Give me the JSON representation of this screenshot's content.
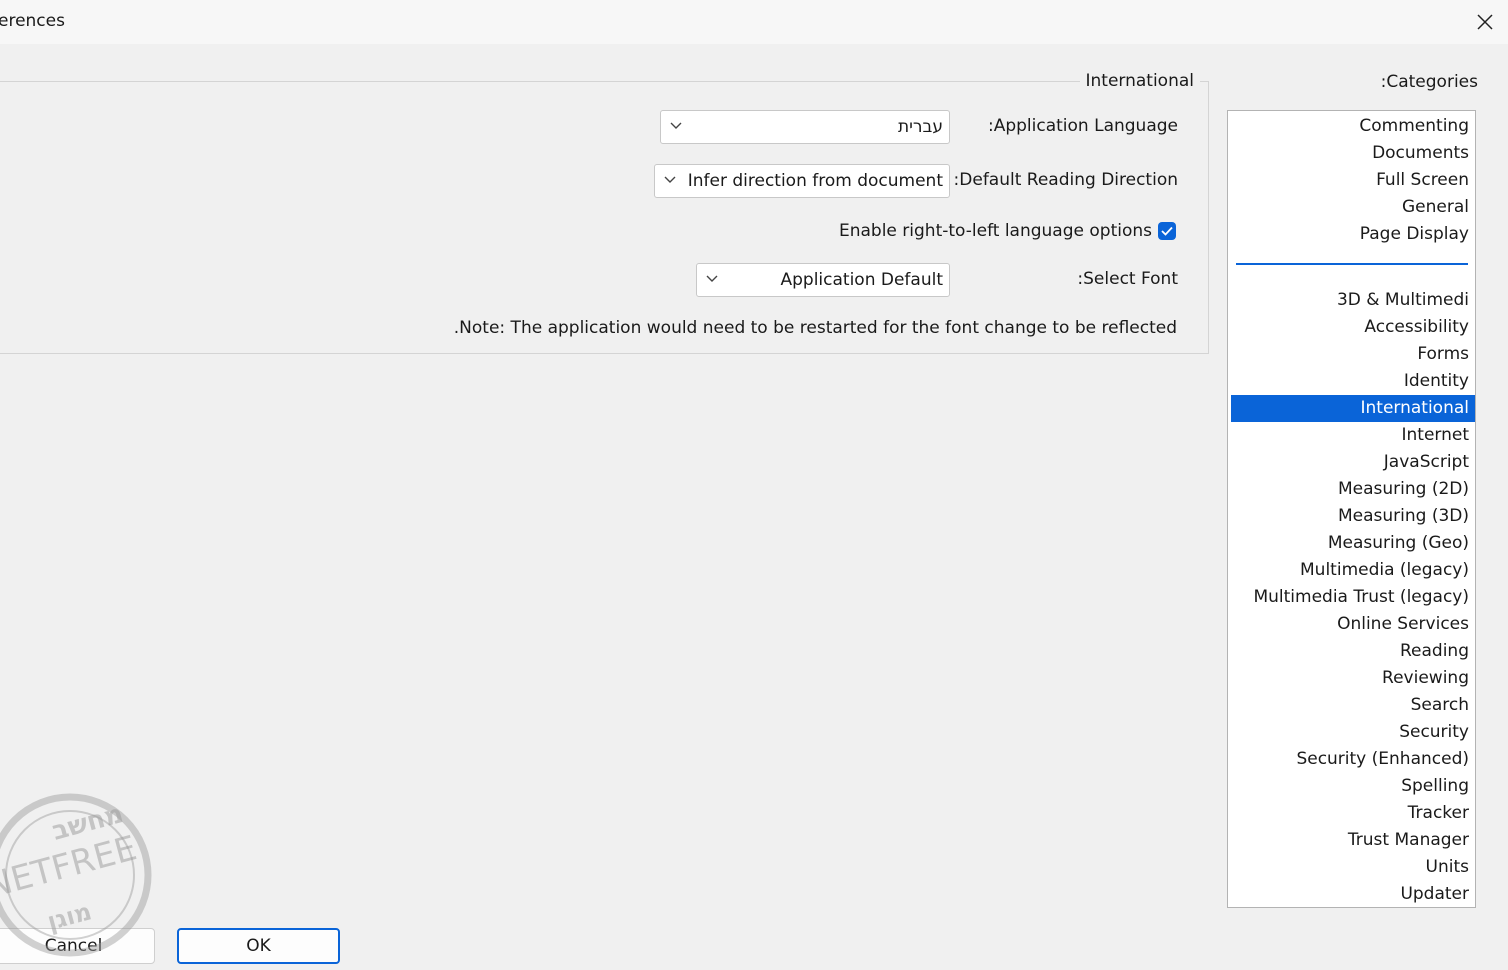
{
  "window": {
    "title": "erences",
    "close_icon": "close-icon"
  },
  "categories": {
    "label": ":Categories",
    "top_items": [
      "Commenting",
      "Documents",
      "Full Screen",
      "General",
      "Page Display"
    ],
    "items": [
      "3D & Multimedi",
      "Accessibility",
      "Forms",
      "Identity",
      "International",
      "Internet",
      "JavaScript",
      "Measuring (2D)",
      "Measuring (3D)",
      "Measuring (Geo)",
      "Multimedia (legacy)",
      "Multimedia Trust (legacy)",
      "Online Services",
      "Reading",
      "Reviewing",
      "Search",
      "Security",
      "Security (Enhanced)",
      "Spelling",
      "Tracker",
      "Trust Manager",
      "Units",
      "Updater"
    ],
    "selected": "International",
    "accent": "#0a64d8"
  },
  "panel": {
    "title": "International",
    "app_language_label": ":Application Language",
    "app_language_value": "עברית",
    "reading_direction_label": ":Default Reading Direction",
    "reading_direction_value": "Infer direction from document",
    "rtl_checkbox_label": "Enable right-to-left language options",
    "rtl_checked": true,
    "select_font_label": ":Select Font",
    "select_font_value": "Application Default",
    "note": ".Note: The application would need to be restarted for the font change to be reflected"
  },
  "buttons": {
    "ok": "OK",
    "cancel": "Cancel"
  },
  "watermark": {
    "top": "מחשב",
    "middle": "NETFREE",
    "bottom": "מוגן"
  }
}
